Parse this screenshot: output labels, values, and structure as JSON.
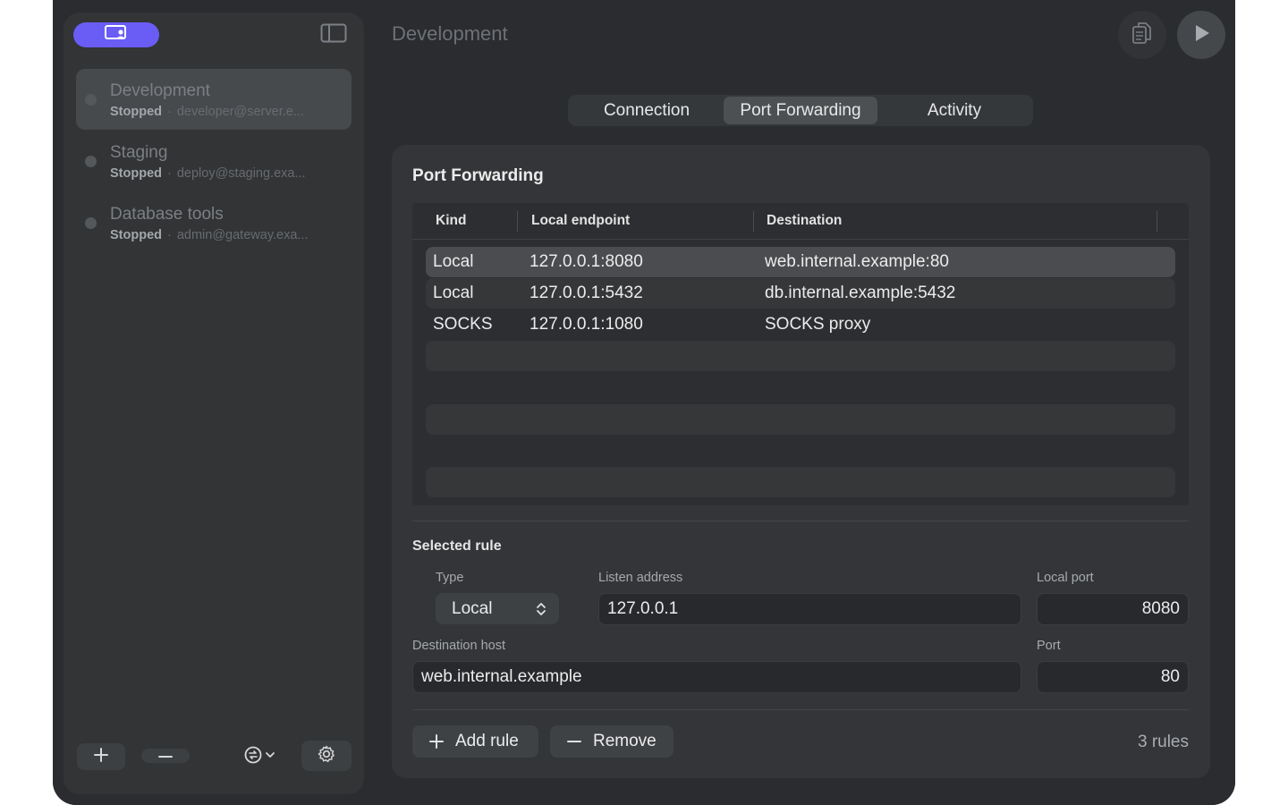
{
  "window": {
    "title": "Development"
  },
  "sidebar": {
    "items": [
      {
        "name": "Development",
        "status": "Stopped",
        "host": "developer@server.e..."
      },
      {
        "name": "Staging",
        "status": "Stopped",
        "host": "deploy@staging.exa..."
      },
      {
        "name": "Database tools",
        "status": "Stopped",
        "host": "admin@gateway.exa..."
      }
    ],
    "separator": "·"
  },
  "tabs": [
    "Connection",
    "Port Forwarding",
    "Activity"
  ],
  "active_tab": "Port Forwarding",
  "panel": {
    "title": "Port Forwarding",
    "columns": [
      "Kind",
      "Local endpoint",
      "Destination"
    ],
    "rows": [
      {
        "kind": "Local",
        "local": "127.0.0.1:8080",
        "destination": "web.internal.example:80",
        "selected": true
      },
      {
        "kind": "Local",
        "local": "127.0.0.1:5432",
        "destination": "db.internal.example:5432",
        "selected": false
      },
      {
        "kind": "SOCKS",
        "local": "127.0.0.1:1080",
        "destination": "SOCKS proxy",
        "selected": false
      }
    ],
    "selected_rule": {
      "title": "Selected rule",
      "type_label": "Type",
      "type_value": "Local",
      "listen_label": "Listen address",
      "listen_value": "127.0.0.1",
      "local_port_label": "Local port",
      "local_port_value": "8080",
      "dest_host_label": "Destination host",
      "dest_host_value": "web.internal.example",
      "port_label": "Port",
      "port_value": "80"
    },
    "add_label": "Add rule",
    "remove_label": "Remove",
    "rule_count": "3 rules"
  },
  "colors": {
    "accent": "#6a5df5",
    "background": "#2a2c2f",
    "panel": "#333538"
  }
}
